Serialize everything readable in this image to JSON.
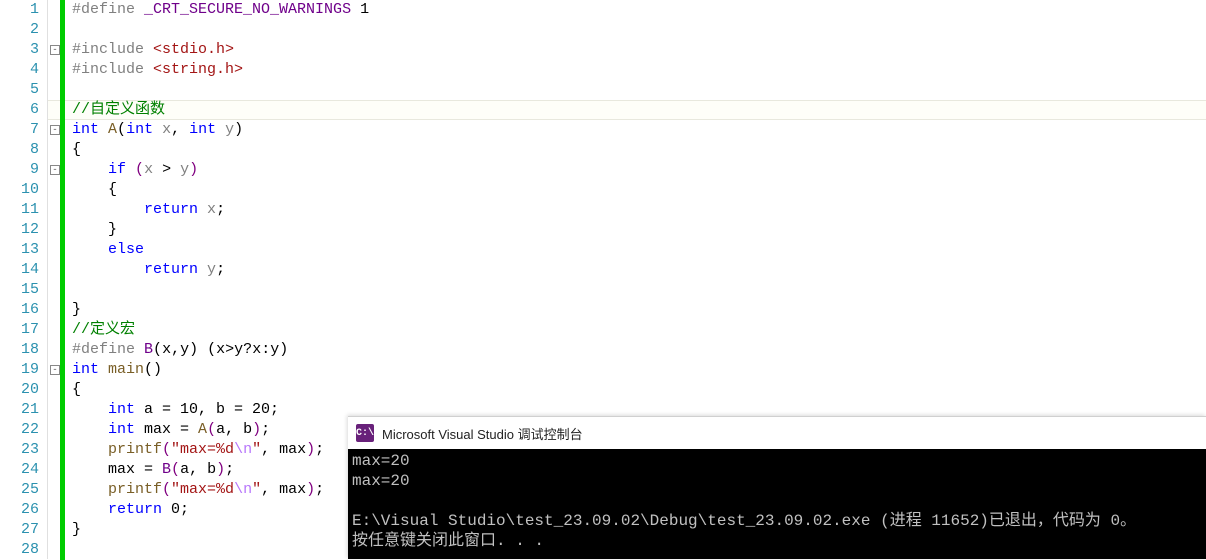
{
  "editor": {
    "highlight_line": 6,
    "lines": [
      {
        "n": 1,
        "indent": 0,
        "tokens": [
          {
            "t": "#define",
            "c": "c-pre"
          },
          {
            "t": " ",
            "c": ""
          },
          {
            "t": "_CRT_SECURE_NO_WARNINGS",
            "c": "c-def"
          },
          {
            "t": " 1",
            "c": "c-text"
          }
        ]
      },
      {
        "n": 2,
        "indent": 0,
        "tokens": []
      },
      {
        "n": 3,
        "indent": 0,
        "fold": "-",
        "tokens": [
          {
            "t": "#include",
            "c": "c-pre"
          },
          {
            "t": " ",
            "c": ""
          },
          {
            "t": "<stdio.h>",
            "c": "c-inc"
          }
        ]
      },
      {
        "n": 4,
        "indent": 0,
        "tokens": [
          {
            "t": "#include",
            "c": "c-pre"
          },
          {
            "t": " ",
            "c": ""
          },
          {
            "t": "<string.h>",
            "c": "c-inc"
          }
        ]
      },
      {
        "n": 5,
        "indent": 0,
        "tokens": []
      },
      {
        "n": 6,
        "indent": 0,
        "tokens": [
          {
            "t": "//自定义函数",
            "c": "c-com"
          }
        ]
      },
      {
        "n": 7,
        "indent": 0,
        "fold": "-",
        "tokens": [
          {
            "t": "int",
            "c": "c-kw"
          },
          {
            "t": " ",
            "c": ""
          },
          {
            "t": "A",
            "c": "c-fn"
          },
          {
            "t": "(",
            "c": "c-op"
          },
          {
            "t": "int",
            "c": "c-kw"
          },
          {
            "t": " ",
            "c": ""
          },
          {
            "t": "x",
            "c": "c-var"
          },
          {
            "t": ", ",
            "c": "c-op"
          },
          {
            "t": "int",
            "c": "c-kw"
          },
          {
            "t": " ",
            "c": ""
          },
          {
            "t": "y",
            "c": "c-var"
          },
          {
            "t": ")",
            "c": "c-op"
          }
        ]
      },
      {
        "n": 8,
        "indent": 0,
        "tokens": [
          {
            "t": "{",
            "c": "c-op"
          }
        ]
      },
      {
        "n": 9,
        "indent": 1,
        "fold": "-",
        "tokens": [
          {
            "t": "if",
            "c": "c-kw"
          },
          {
            "t": " ",
            "c": ""
          },
          {
            "t": "(",
            "c": "c-par"
          },
          {
            "t": "x",
            "c": "c-var"
          },
          {
            "t": " > ",
            "c": "c-op"
          },
          {
            "t": "y",
            "c": "c-var"
          },
          {
            "t": ")",
            "c": "c-par"
          }
        ]
      },
      {
        "n": 10,
        "indent": 1,
        "tokens": [
          {
            "t": "{",
            "c": "c-op"
          }
        ]
      },
      {
        "n": 11,
        "indent": 2,
        "tokens": [
          {
            "t": "return",
            "c": "c-kw"
          },
          {
            "t": " ",
            "c": ""
          },
          {
            "t": "x",
            "c": "c-var"
          },
          {
            "t": ";",
            "c": "c-op"
          }
        ]
      },
      {
        "n": 12,
        "indent": 1,
        "tokens": [
          {
            "t": "}",
            "c": "c-op"
          }
        ]
      },
      {
        "n": 13,
        "indent": 1,
        "tokens": [
          {
            "t": "else",
            "c": "c-kw"
          }
        ]
      },
      {
        "n": 14,
        "indent": 2,
        "tokens": [
          {
            "t": "return",
            "c": "c-kw"
          },
          {
            "t": " ",
            "c": ""
          },
          {
            "t": "y",
            "c": "c-var"
          },
          {
            "t": ";",
            "c": "c-op"
          }
        ]
      },
      {
        "n": 15,
        "indent": 0,
        "tokens": []
      },
      {
        "n": 16,
        "indent": 0,
        "tokens": [
          {
            "t": "}",
            "c": "c-op"
          }
        ]
      },
      {
        "n": 17,
        "indent": 0,
        "tokens": [
          {
            "t": "//定义宏",
            "c": "c-com"
          }
        ]
      },
      {
        "n": 18,
        "indent": 0,
        "tokens": [
          {
            "t": "#define",
            "c": "c-pre"
          },
          {
            "t": " ",
            "c": ""
          },
          {
            "t": "B",
            "c": "c-macro"
          },
          {
            "t": "(",
            "c": "c-op"
          },
          {
            "t": "x",
            "c": "c-text"
          },
          {
            "t": ",",
            "c": "c-op"
          },
          {
            "t": "y",
            "c": "c-text"
          },
          {
            "t": ") (",
            "c": "c-op"
          },
          {
            "t": "x",
            "c": "c-text"
          },
          {
            "t": ">",
            "c": "c-op"
          },
          {
            "t": "y",
            "c": "c-text"
          },
          {
            "t": "?",
            "c": "c-op"
          },
          {
            "t": "x",
            "c": "c-text"
          },
          {
            "t": ":",
            "c": "c-op"
          },
          {
            "t": "y",
            "c": "c-text"
          },
          {
            "t": ")",
            "c": "c-op"
          }
        ]
      },
      {
        "n": 19,
        "indent": 0,
        "fold": "-",
        "tokens": [
          {
            "t": "int",
            "c": "c-kw"
          },
          {
            "t": " ",
            "c": ""
          },
          {
            "t": "main",
            "c": "c-fn"
          },
          {
            "t": "()",
            "c": "c-op"
          }
        ]
      },
      {
        "n": 20,
        "indent": 0,
        "tokens": [
          {
            "t": "{",
            "c": "c-op"
          }
        ]
      },
      {
        "n": 21,
        "indent": 1,
        "tokens": [
          {
            "t": "int",
            "c": "c-kw"
          },
          {
            "t": " a = 10, b = 20;",
            "c": "c-text"
          }
        ]
      },
      {
        "n": 22,
        "indent": 1,
        "tokens": [
          {
            "t": "int",
            "c": "c-kw"
          },
          {
            "t": " max = ",
            "c": "c-text"
          },
          {
            "t": "A",
            "c": "c-fn"
          },
          {
            "t": "(",
            "c": "c-par"
          },
          {
            "t": "a, b",
            "c": "c-text"
          },
          {
            "t": ")",
            "c": "c-par"
          },
          {
            "t": ";",
            "c": "c-op"
          }
        ]
      },
      {
        "n": 23,
        "indent": 1,
        "tokens": [
          {
            "t": "printf",
            "c": "c-fn"
          },
          {
            "t": "(",
            "c": "c-par"
          },
          {
            "t": "\"max=%d",
            "c": "c-str"
          },
          {
            "t": "\\n",
            "c": "c-esc"
          },
          {
            "t": "\"",
            "c": "c-str"
          },
          {
            "t": ", max",
            "c": "c-text"
          },
          {
            "t": ")",
            "c": "c-par"
          },
          {
            "t": ";",
            "c": "c-op"
          }
        ]
      },
      {
        "n": 24,
        "indent": 1,
        "tokens": [
          {
            "t": "max = ",
            "c": "c-text"
          },
          {
            "t": "B",
            "c": "c-macro"
          },
          {
            "t": "(",
            "c": "c-par"
          },
          {
            "t": "a, b",
            "c": "c-text"
          },
          {
            "t": ")",
            "c": "c-par"
          },
          {
            "t": ";",
            "c": "c-op"
          }
        ]
      },
      {
        "n": 25,
        "indent": 1,
        "tokens": [
          {
            "t": "printf",
            "c": "c-fn"
          },
          {
            "t": "(",
            "c": "c-par"
          },
          {
            "t": "\"max=%d",
            "c": "c-str"
          },
          {
            "t": "\\n",
            "c": "c-esc"
          },
          {
            "t": "\"",
            "c": "c-str"
          },
          {
            "t": ", max",
            "c": "c-text"
          },
          {
            "t": ")",
            "c": "c-par"
          },
          {
            "t": ";",
            "c": "c-op"
          }
        ]
      },
      {
        "n": 26,
        "indent": 1,
        "tokens": [
          {
            "t": "return",
            "c": "c-kw"
          },
          {
            "t": " 0;",
            "c": "c-text"
          }
        ]
      },
      {
        "n": 27,
        "indent": 0,
        "tokens": [
          {
            "t": "}",
            "c": "c-op"
          }
        ]
      },
      {
        "n": 28,
        "indent": 0,
        "tokens": []
      }
    ]
  },
  "console": {
    "icon_text": "C:\\",
    "title": "Microsoft Visual Studio 调试控制台",
    "lines": [
      "max=20",
      "max=20",
      "",
      "E:\\Visual Studio\\test_23.09.02\\Debug\\test_23.09.02.exe (进程 11652)已退出，代码为 0。",
      "按任意键关闭此窗口. . ."
    ]
  }
}
